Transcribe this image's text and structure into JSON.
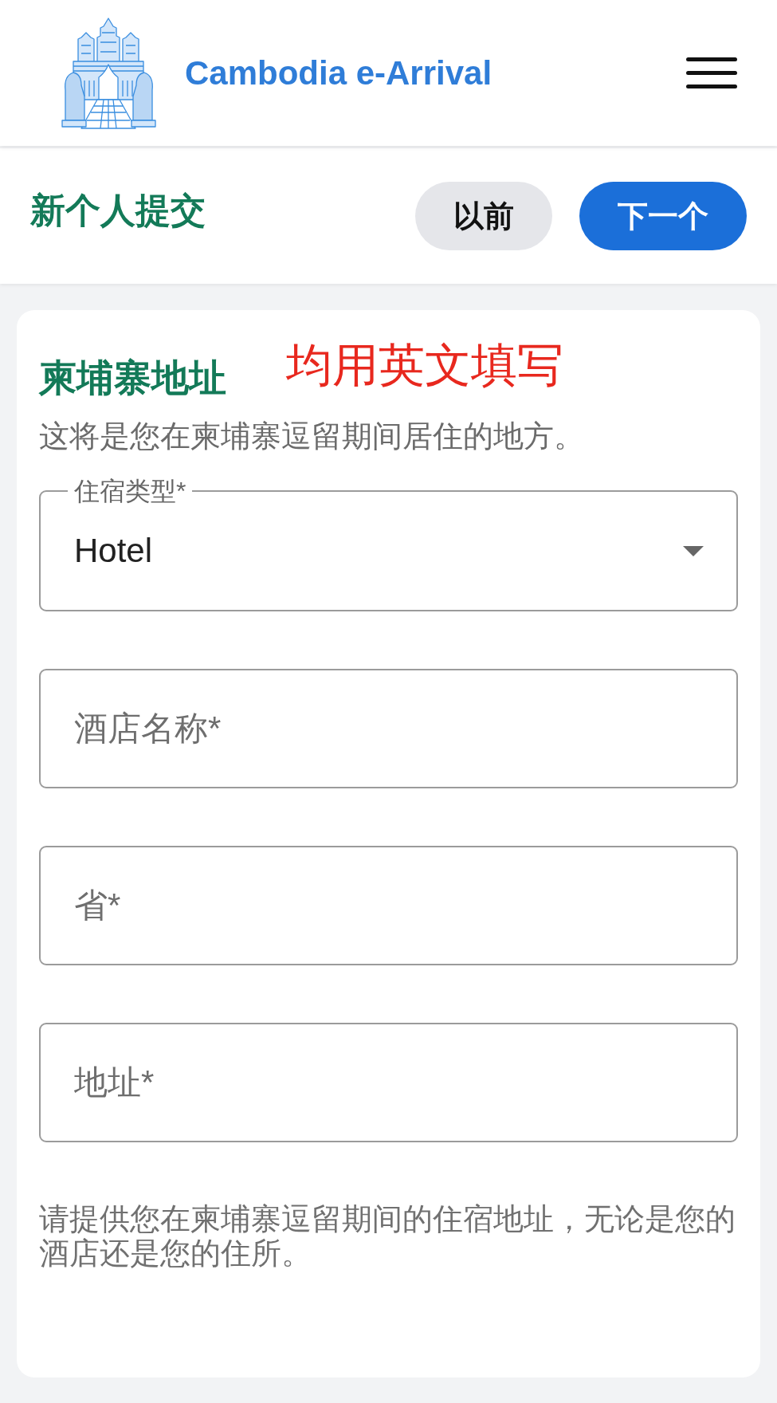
{
  "header": {
    "title": "Cambodia e-Arrival"
  },
  "toolbar": {
    "title": "新个人提交",
    "buttons": [
      {
        "label": "以前",
        "kind": "secondary"
      },
      {
        "label": "下一个",
        "kind": "primary"
      }
    ]
  },
  "card": {
    "title": "柬埔寨地址",
    "annotation": "均用英文填写",
    "description": "这将是您在柬埔寨逗留期间居住的地方。",
    "fields": [
      {
        "kind": "select",
        "label": "住宿类型*",
        "value": "Hotel"
      },
      {
        "kind": "text",
        "placeholder": "酒店名称*"
      },
      {
        "kind": "text",
        "placeholder": "省*"
      },
      {
        "kind": "text",
        "placeholder": "地址*"
      }
    ],
    "help": "请提供您在柬埔寨逗留期间的住宿地址，无论是您的酒店还是您的住所。"
  }
}
